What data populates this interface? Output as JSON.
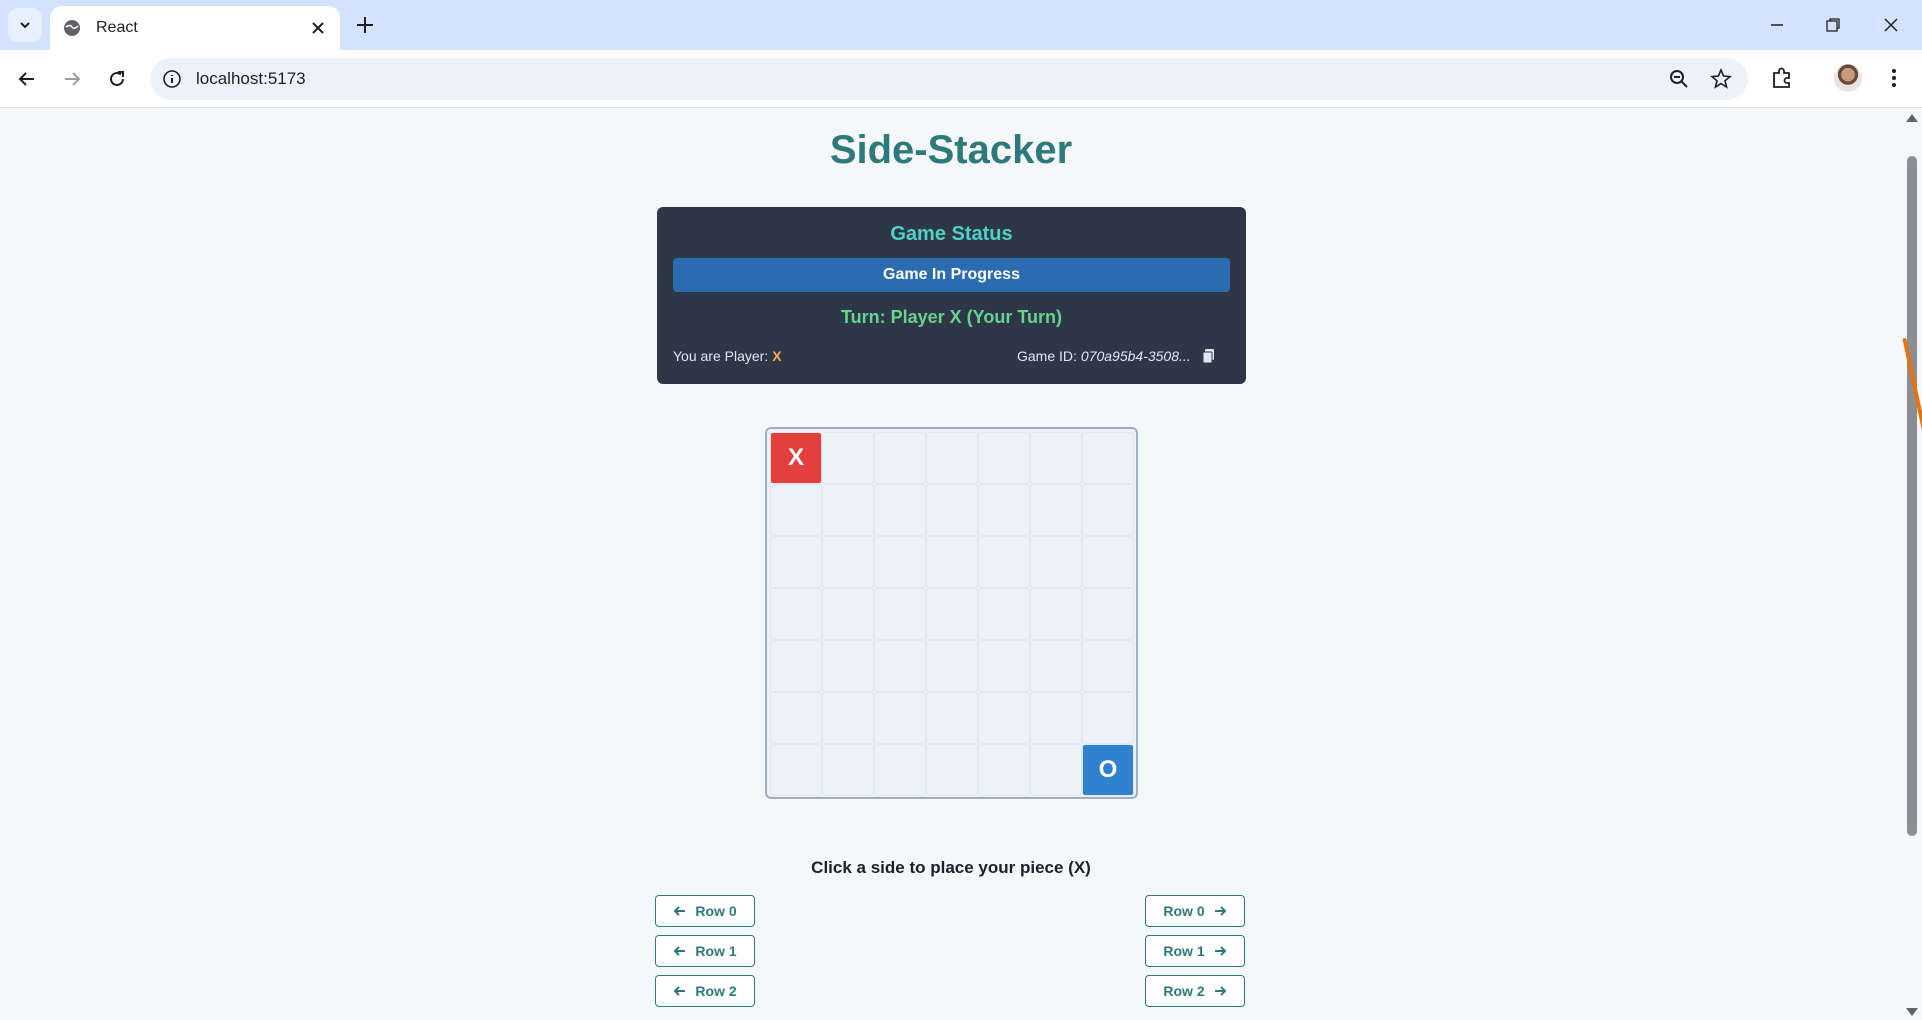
{
  "browser": {
    "tab_title": "React",
    "url": "localhost:5173"
  },
  "app": {
    "title": "Side-Stacker"
  },
  "status": {
    "heading": "Game Status",
    "state": "Game In Progress",
    "turn": "Turn: Player X (Your Turn)",
    "player_label": "You are Player:",
    "player_value": "X",
    "game_id_label": "Game ID:",
    "game_id_value": "070a95b4-3508..."
  },
  "board": {
    "rows": [
      [
        "X",
        "",
        "",
        "",
        "",
        "",
        ""
      ],
      [
        "",
        "",
        "",
        "",
        "",
        "",
        ""
      ],
      [
        "",
        "",
        "",
        "",
        "",
        "",
        ""
      ],
      [
        "",
        "",
        "",
        "",
        "",
        "",
        ""
      ],
      [
        "",
        "",
        "",
        "",
        "",
        "",
        ""
      ],
      [
        "",
        "",
        "",
        "",
        "",
        "",
        ""
      ],
      [
        "",
        "",
        "",
        "",
        "",
        "",
        "O"
      ]
    ]
  },
  "controls": {
    "instruction": "Click a side to place your piece (X)",
    "left_buttons": [
      "Row 0",
      "Row 1",
      "Row 2"
    ],
    "right_buttons": [
      "Row 0",
      "Row 1",
      "Row 2"
    ]
  },
  "colors": {
    "accent": "#2c7a7b",
    "piece_x": "#e53e3e",
    "piece_o": "#3182ce"
  }
}
